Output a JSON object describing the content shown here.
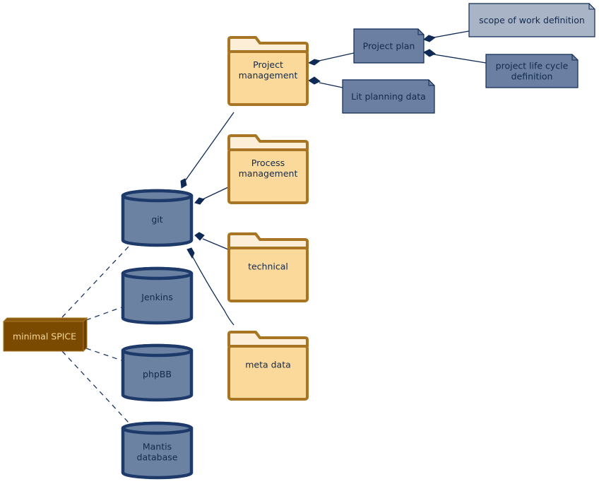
{
  "diagram": {
    "root": {
      "label": "minimal SPICE",
      "type": "node"
    },
    "databases": [
      {
        "id": "git",
        "lines": [
          "git"
        ]
      },
      {
        "id": "jenkins",
        "lines": [
          "Jenkins"
        ]
      },
      {
        "id": "phpbb",
        "lines": [
          "phpBB"
        ]
      },
      {
        "id": "mantis",
        "lines": [
          "Mantis",
          "database"
        ]
      }
    ],
    "folders": [
      {
        "id": "project-management",
        "lines": [
          "Project",
          "management"
        ]
      },
      {
        "id": "process-management",
        "lines": [
          "Process",
          "management"
        ]
      },
      {
        "id": "technical",
        "lines": [
          "technical"
        ]
      },
      {
        "id": "meta-data",
        "lines": [
          "meta data"
        ]
      }
    ],
    "artifacts": [
      {
        "id": "project-plan",
        "lines": [
          "Project plan"
        ],
        "shade": "dark"
      },
      {
        "id": "lit-planning-data",
        "lines": [
          "Lit planning data"
        ],
        "shade": "dark"
      },
      {
        "id": "scope-of-work-definition",
        "lines": [
          "scope of work definition"
        ],
        "shade": "light"
      },
      {
        "id": "project-life-cycle-definition",
        "lines": [
          "project life cycle",
          "definition"
        ],
        "shade": "dark"
      }
    ],
    "connections": [
      {
        "from": "minimal SPICE",
        "to": "git",
        "style": "dashed"
      },
      {
        "from": "minimal SPICE",
        "to": "Jenkins",
        "style": "dashed"
      },
      {
        "from": "minimal SPICE",
        "to": "phpBB",
        "style": "dashed"
      },
      {
        "from": "minimal SPICE",
        "to": "Mantis database",
        "style": "dashed"
      },
      {
        "from": "git",
        "to": "Project management",
        "style": "composition"
      },
      {
        "from": "git",
        "to": "Process management",
        "style": "composition"
      },
      {
        "from": "git",
        "to": "technical",
        "style": "composition"
      },
      {
        "from": "git",
        "to": "meta data",
        "style": "composition"
      },
      {
        "from": "Project management",
        "to": "Project plan",
        "style": "composition"
      },
      {
        "from": "Project management",
        "to": "Lit planning data",
        "style": "composition"
      },
      {
        "from": "Project plan",
        "to": "scope of work definition",
        "style": "composition"
      },
      {
        "from": "Project plan",
        "to": "project life cycle definition",
        "style": "composition"
      }
    ],
    "colors": {
      "node_fill": "#7a4a00",
      "node_text": "#f3d79b",
      "db_fill": "#6c82a3",
      "db_stroke": "#1e3a6b",
      "folder_fill": "#fbd99b",
      "folder_tab": "#fdefd7",
      "folder_stroke": "#a87524",
      "artifact_dark": "#6a7fa1",
      "artifact_light": "#a9b5c7",
      "artifact_stroke": "#0f2a55",
      "edge": "#0f2a55"
    }
  }
}
